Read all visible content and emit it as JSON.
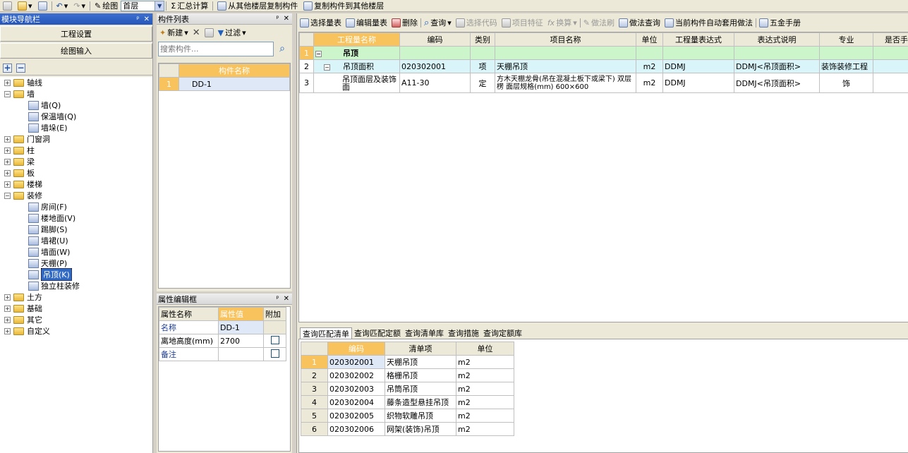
{
  "toolbar": {
    "draw_label": "绘图",
    "layer_value": "首层",
    "sum_label": "汇总计算",
    "copy_from_label": "从其他楼层复制构件",
    "copy_to_label": "复制构件到其他楼层"
  },
  "nav": {
    "title": "模块导航栏",
    "project_settings": "工程设置",
    "drawing_input": "绘图输入",
    "tree": [
      {
        "label": "轴线",
        "level": 0,
        "type": "folder",
        "expanded": false
      },
      {
        "label": "墙",
        "level": 0,
        "type": "folder",
        "expanded": true
      },
      {
        "label": "墙(Q)",
        "level": 1,
        "type": "leaf"
      },
      {
        "label": "保温墙(Q)",
        "level": 1,
        "type": "leaf"
      },
      {
        "label": "墙垛(E)",
        "level": 1,
        "type": "leaf"
      },
      {
        "label": "门窗洞",
        "level": 0,
        "type": "folder",
        "expanded": false
      },
      {
        "label": "柱",
        "level": 0,
        "type": "folder",
        "expanded": false
      },
      {
        "label": "梁",
        "level": 0,
        "type": "folder",
        "expanded": false
      },
      {
        "label": "板",
        "level": 0,
        "type": "folder",
        "expanded": false
      },
      {
        "label": "楼梯",
        "level": 0,
        "type": "folder",
        "expanded": false
      },
      {
        "label": "装修",
        "level": 0,
        "type": "folder",
        "expanded": true
      },
      {
        "label": "房间(F)",
        "level": 1,
        "type": "leaf"
      },
      {
        "label": "楼地面(V)",
        "level": 1,
        "type": "leaf"
      },
      {
        "label": "踢脚(S)",
        "level": 1,
        "type": "leaf"
      },
      {
        "label": "墙裙(U)",
        "level": 1,
        "type": "leaf"
      },
      {
        "label": "墙面(W)",
        "level": 1,
        "type": "leaf"
      },
      {
        "label": "天棚(P)",
        "level": 1,
        "type": "leaf"
      },
      {
        "label": "吊顶(K)",
        "level": 1,
        "type": "leaf",
        "selected": true
      },
      {
        "label": "独立柱装修",
        "level": 1,
        "type": "leaf"
      },
      {
        "label": "土方",
        "level": 0,
        "type": "folder",
        "expanded": false
      },
      {
        "label": "基础",
        "level": 0,
        "type": "folder",
        "expanded": false
      },
      {
        "label": "其它",
        "level": 0,
        "type": "folder",
        "expanded": false
      },
      {
        "label": "自定义",
        "level": 0,
        "type": "folder",
        "expanded": false
      }
    ]
  },
  "component_list": {
    "title": "构件列表",
    "new_label": "新建",
    "filter_label": "过滤",
    "search_placeholder": "搜索构件...",
    "column": "构件名称",
    "rows": [
      {
        "num": "1",
        "name": "DD-1"
      }
    ]
  },
  "properties": {
    "title": "属性编辑框",
    "headers": [
      "属性名称",
      "属性值",
      "附加"
    ],
    "rows": [
      {
        "name": "名称",
        "value": "DD-1",
        "checkbox": false
      },
      {
        "name": "离地高度(mm)",
        "value": "2700",
        "checkbox": true
      },
      {
        "name": "备注",
        "value": "",
        "checkbox": true
      }
    ]
  },
  "main_toolbar": {
    "select_qty": "选择量表",
    "edit_qty": "编辑量表",
    "delete": "删除",
    "query": "查询",
    "select_code": "选择代码",
    "item_feature": "项目特征",
    "convert": "换算",
    "method_brush": "做法刷",
    "method_query": "做法查询",
    "auto_apply": "当前构件自动套用做法",
    "hardware_manual": "五金手册"
  },
  "main_grid": {
    "headers": [
      "工程量名称",
      "编码",
      "类别",
      "项目名称",
      "单位",
      "工程量表达式",
      "表达式说明",
      "专业",
      "是否手动"
    ],
    "rows": [
      {
        "num": "1",
        "qty_name": "吊顶",
        "code": "",
        "type": "",
        "item": "",
        "unit": "",
        "expr": "",
        "expr_desc": "",
        "major": "",
        "manual": null,
        "group": true
      },
      {
        "num": "2",
        "qty_name": "吊顶面积",
        "code": "020302001",
        "type": "项",
        "item": "天棚吊顶",
        "unit": "m2",
        "expr": "DDMJ",
        "expr_desc": "DDMJ<吊顶面积>",
        "major": "装饰装修工程",
        "manual": true
      },
      {
        "num": "3",
        "qty_name": "吊顶面层及装饰面",
        "code": "A11-30",
        "type": "定",
        "item": "方木天棚龙骨(吊在混凝土板下或梁下) 双层楞 面层规格(mm) 600×600",
        "unit": "m2",
        "expr": "DDMJ",
        "expr_desc": "DDMJ<吊顶面积>",
        "major": "饰",
        "manual": true
      }
    ]
  },
  "bottom_tabs": [
    "查询匹配清单",
    "查询匹配定额",
    "查询清单库",
    "查询措施",
    "查询定额库"
  ],
  "bottom_grid": {
    "headers": [
      "编码",
      "清单项",
      "单位"
    ],
    "rows": [
      {
        "num": "1",
        "code": "020302001",
        "name": "天棚吊顶",
        "unit": "m2"
      },
      {
        "num": "2",
        "code": "020302002",
        "name": "格栅吊顶",
        "unit": "m2"
      },
      {
        "num": "3",
        "code": "020302003",
        "name": "吊筒吊顶",
        "unit": "m2"
      },
      {
        "num": "4",
        "code": "020302004",
        "name": "藤条造型悬挂吊顶",
        "unit": "m2"
      },
      {
        "num": "5",
        "code": "020302005",
        "name": "织物软雕吊顶",
        "unit": "m2"
      },
      {
        "num": "6",
        "code": "020302006",
        "name": "网架(装饰)吊顶",
        "unit": "m2"
      }
    ]
  }
}
